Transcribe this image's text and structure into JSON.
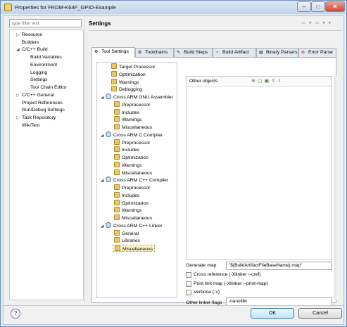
{
  "window": {
    "title": "Properties for FRDM-K64F_GPIO-Example",
    "min": "–",
    "max": "□",
    "close": "✕"
  },
  "filter": {
    "placeholder": "type filter text"
  },
  "nav": {
    "resource": "Resource",
    "builders": "Builders",
    "cpp_build": "C/C++ Build",
    "build_variables": "Build Variables",
    "environment": "Environment",
    "logging": "Logging",
    "settings": "Settings",
    "tool_chain_editor": "Tool Chain Editor",
    "cpp_general": "C/C++ General",
    "project_references": "Project References",
    "run_debug": "Run/Debug Settings",
    "task_repository": "Task Repository",
    "wikitext": "WikiText"
  },
  "header": {
    "title": "Settings",
    "arrows": "⇦ ▾ ⇨ ▾ ▾"
  },
  "tabs": {
    "tool_settings": "Tool Settings",
    "toolchains": "Toolchains",
    "build_steps": "Build Steps",
    "build_artifact": "Build Artifact",
    "binary_parsers": "Binary Parsers",
    "error_parsers": "Error Parse"
  },
  "tree": {
    "target_processor": "Target Processor",
    "optimization": "Optimization",
    "warnings": "Warnings",
    "debugging": "Debugging",
    "asm": "Cross ARM GNU Assembler",
    "asm_pre": "Preprocessor",
    "asm_inc": "Includes",
    "asm_warn": "Warnings",
    "asm_misc": "Miscellaneous",
    "c": "Cross ARM C Compiler",
    "c_pre": "Preprocessor",
    "c_inc": "Includes",
    "c_opt": "Optimization",
    "c_warn": "Warnings",
    "c_misc": "Miscellaneous",
    "cpp": "Cross ARM C++ Compiler",
    "cpp_pre": "Preprocessor",
    "cpp_inc": "Includes",
    "cpp_opt": "Optimization",
    "cpp_warn": "Warnings",
    "cpp_misc": "Miscellaneous",
    "linker": "Cross ARM C++ Linker",
    "link_general": "General",
    "link_libs": "Libraries",
    "link_misc": "Miscellaneous"
  },
  "panel": {
    "other_objects": "Other objects",
    "generate_map_label": "Generate map",
    "generate_map_value": "\"${BuildArtifactFileBaseName}.map\"",
    "cross_reference": "Cross reference (-Xlinker --cref)",
    "print_link_map": "Print link map (-Xlinker --print-map)",
    "verbose": "Verbose (-v)",
    "other_linker_flags_label": "Other linker flags",
    "other_linker_flags_value": "-nanolibc"
  },
  "footer": {
    "help": "?",
    "ok": "OK",
    "cancel": "Cancel"
  }
}
